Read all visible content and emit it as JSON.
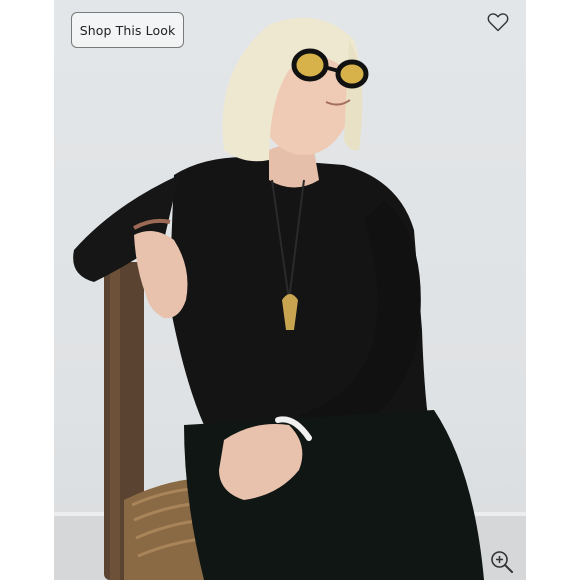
{
  "product_image": {
    "shop_button_label": "Shop This Look",
    "icons": {
      "favorite": "heart-outline-icon",
      "zoom": "zoom-in-icon"
    },
    "colors": {
      "background": "#e1e4e6",
      "button_border": "#7a7a7a",
      "icon": "#333333"
    }
  }
}
